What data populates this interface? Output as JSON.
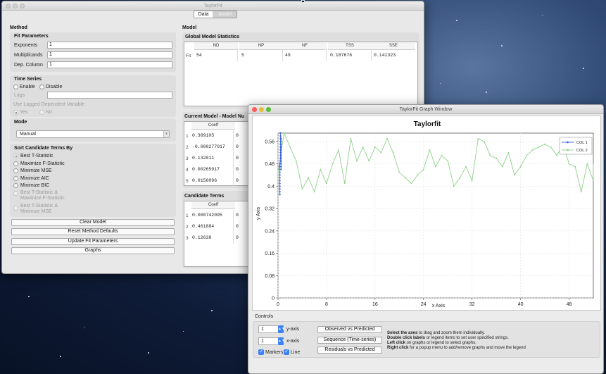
{
  "main_window": {
    "title": "TaylorFit",
    "tabs": [
      "Data",
      "Model"
    ],
    "active_tab": 0,
    "method": {
      "heading": "Method",
      "fit_parameters": {
        "heading": "Fit Parameters",
        "exponents_label": "Exponents",
        "exponents_value": "1",
        "multiplicands_label": "Multiplicands",
        "multiplicands_value": "1",
        "dep_column_label": "Dep. Column",
        "dep_column_value": "1"
      },
      "time_series": {
        "heading": "Time Series",
        "enable_label": "Enable",
        "disable_label": "Disable",
        "lags_label": "Lags",
        "lags_value": "",
        "use_lagged_label": "Use Lagged Dependent Variable",
        "yes_label": "Yes",
        "no_label": "No"
      },
      "mode": {
        "heading": "Mode",
        "selected": "Manual"
      },
      "sort": {
        "heading": "Sort Candidate Terms By",
        "options": [
          {
            "label": "Best T-Statistic",
            "selected": true,
            "disabled": false
          },
          {
            "label": "Maximize F-Statistic",
            "selected": false,
            "disabled": false
          },
          {
            "label": "Minimize MSE",
            "selected": false,
            "disabled": false
          },
          {
            "label": "Minimize AIC",
            "selected": false,
            "disabled": false
          },
          {
            "label": "Minimize BIC",
            "selected": false,
            "disabled": false
          },
          {
            "label": "Best T-Statistic & Maximize F-Statistic",
            "line1": "Best T-Statistic &",
            "line2": "Maximize F-Statistic",
            "selected": false,
            "disabled": true
          },
          {
            "label": "Best T-Statistic & Minimize MSE",
            "line1": "Best T-Statistic &",
            "line2": "Minimize MSE",
            "selected": false,
            "disabled": true
          }
        ]
      },
      "buttons": [
        "Clear Model",
        "Reset Method Defaults",
        "Update Fit Parameters",
        "Graphs"
      ]
    },
    "model": {
      "heading": "Model",
      "global_stats": {
        "heading": "Global Model Statistics",
        "columns": [
          "ND",
          "NP",
          "NF",
          "TSS",
          "SSE"
        ],
        "row_label": "Fit",
        "values": [
          "54",
          "5",
          "49",
          "0.187676",
          "0.141323"
        ]
      },
      "current_model": {
        "heading": "Current Model - Model Nu",
        "column": "Coeff",
        "rows": [
          {
            "n": "1",
            "coeff": "0.389105",
            "next": "0"
          },
          {
            "n": "2",
            "coeff": "-0.000277017",
            "next": "0"
          },
          {
            "n": "3",
            "coeff": "0.132011",
            "next": "0"
          },
          {
            "n": "4",
            "coeff": "0.00265917",
            "next": "0"
          },
          {
            "n": "5",
            "coeff": "0.0156096",
            "next": "0"
          }
        ]
      },
      "candidate_terms": {
        "heading": "Candidate Terms",
        "column": "Coeff",
        "rows": [
          {
            "n": "1",
            "coeff": "0.000742095",
            "next": "0"
          },
          {
            "n": "2",
            "coeff": "0.461884",
            "next": "0"
          },
          {
            "n": "3",
            "coeff": "0.12638",
            "next": "0"
          }
        ]
      }
    }
  },
  "graph_window": {
    "title": "TaylorFit Graph Window",
    "controls_heading": "Controls",
    "y_axis_label": "y-axis",
    "y_axis_value": "1",
    "x_axis_label": "x-axis",
    "x_axis_value": "1",
    "markers_label": "Markers",
    "line_label": "Line",
    "buttons": [
      "Observed vs Predicted",
      "Sequence (Time-series)",
      "Residuals vs Predicted"
    ],
    "help": [
      {
        "bold": "Select the axes",
        "rest": " to drag and zoom them individually."
      },
      {
        "bold": "Double click labels",
        "rest": " or legend items to set user specified strings."
      },
      {
        "bold": "Left click",
        "rest": " on graphs or legend to select graphs."
      },
      {
        "bold": "Right click",
        "rest": " for a popup menu to add/remove graphs and move the legend"
      }
    ]
  },
  "chart_data": {
    "type": "scatter",
    "title": "Taylorfit",
    "xlabel": "x Axis",
    "ylabel": "y Axis",
    "xlim": [
      0,
      52
    ],
    "ylim": [
      0,
      0.59
    ],
    "xticks": [
      0,
      8,
      16,
      24,
      32,
      40,
      48
    ],
    "yticks": [
      0,
      0.08,
      0.16,
      0.24,
      0.32,
      0.4,
      0.48,
      0.56
    ],
    "ytick_labels": [
      "0",
      "0.08",
      "0.16",
      "0.24",
      "0.32",
      "0.4",
      "0.48",
      "0.56"
    ],
    "grid": true,
    "legend_position": "top-right",
    "series": [
      {
        "name": "COL 1",
        "color": "#3c64d8",
        "style": "markers",
        "x": [
          0.3,
          0.3,
          0.3,
          0.3,
          0.3,
          0.3,
          0.3,
          0.3,
          0.3,
          0.3,
          0.3,
          0.3,
          0.4,
          0.4,
          0.4,
          0.4,
          0.4,
          0.4,
          0.4,
          0.4,
          0.4,
          0.4,
          0.4,
          0.4,
          0.5,
          0.5,
          0.5,
          0.5,
          0.5,
          0.5,
          0.5,
          0.5,
          0.5,
          0.5,
          0.5,
          0.5
        ],
        "values": [
          0.37,
          0.38,
          0.39,
          0.4,
          0.41,
          0.42,
          0.43,
          0.44,
          0.45,
          0.46,
          0.47,
          0.48,
          0.49,
          0.5,
          0.51,
          0.52,
          0.53,
          0.54,
          0.55,
          0.56,
          0.57,
          0.58,
          0.59,
          0.58,
          0.57,
          0.56,
          0.55,
          0.54,
          0.53,
          0.52,
          0.51,
          0.5,
          0.49,
          0.48,
          0.47,
          0.46
        ]
      },
      {
        "name": "COL 2",
        "color": "#8fd08a",
        "style": "line+markers",
        "x": [
          0,
          1,
          2,
          3,
          4,
          5,
          6,
          7,
          8,
          9,
          10,
          11,
          12,
          13,
          14,
          15,
          16,
          17,
          18,
          19,
          20,
          21,
          22,
          23,
          24,
          25,
          26,
          27,
          28,
          29,
          30,
          31,
          32,
          33,
          34,
          35,
          36,
          37,
          38,
          39,
          40,
          41,
          42,
          43,
          44,
          45,
          46,
          47,
          48,
          49,
          50,
          51,
          52,
          53
        ],
        "values": [
          0.45,
          0.59,
          0.54,
          0.49,
          0.39,
          0.43,
          0.38,
          0.46,
          0.41,
          0.48,
          0.53,
          0.41,
          0.57,
          0.49,
          0.54,
          0.49,
          0.54,
          0.52,
          0.57,
          0.52,
          0.45,
          0.43,
          0.41,
          0.44,
          0.46,
          0.53,
          0.47,
          0.51,
          0.49,
          0.4,
          0.43,
          0.47,
          0.42,
          0.57,
          0.56,
          0.51,
          0.5,
          0.47,
          0.52,
          0.44,
          0.47,
          0.51,
          0.53,
          0.54,
          0.55,
          0.54,
          0.51,
          0.55,
          0.48,
          0.47,
          0.38,
          0.48,
          0.42,
          0.48
        ]
      }
    ]
  }
}
